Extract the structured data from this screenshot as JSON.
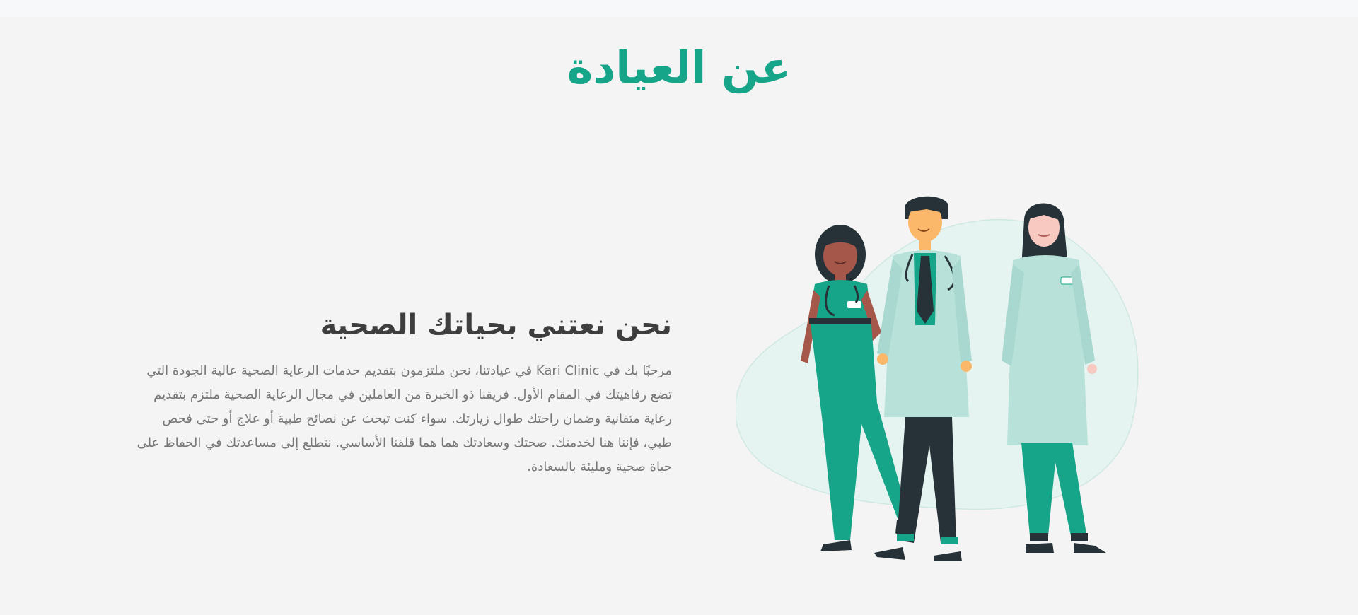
{
  "section": {
    "title": "عن العيادة",
    "subtitle": "نحن نعتني بحياتك الصحية",
    "description": "مرحبًا بك في Kari Clinic في عيادتنا، نحن ملتزمون بتقديم خدمات الرعاية الصحية عالية الجودة التي تضع رفاهيتك في المقام الأول. فريقنا ذو الخبرة من العاملين في مجال الرعاية الصحية ملتزم بتقديم رعاية متفانية وضمان راحتك طوال زيارتك. سواء كنت تبحث عن نصائح طبية أو علاج أو حتى فحص طبي، فإننا هنا لخدمتك. صحتك وسعادتك هما هما قلقنا الأساسي. نتطلع إلى مساعدتك في الحفاظ على حياة صحية ومليئة بالسعادة."
  },
  "illustration": {
    "icon": "medical-team-illustration",
    "colors": {
      "primary_green": "#17a589",
      "light_green": "#b8e2d9",
      "blob": "#e6f4f1",
      "dark": "#263238",
      "skin_dark": "#a5574a",
      "skin_light": "#fbb86a",
      "skin_pale": "#f7c9c1"
    }
  }
}
